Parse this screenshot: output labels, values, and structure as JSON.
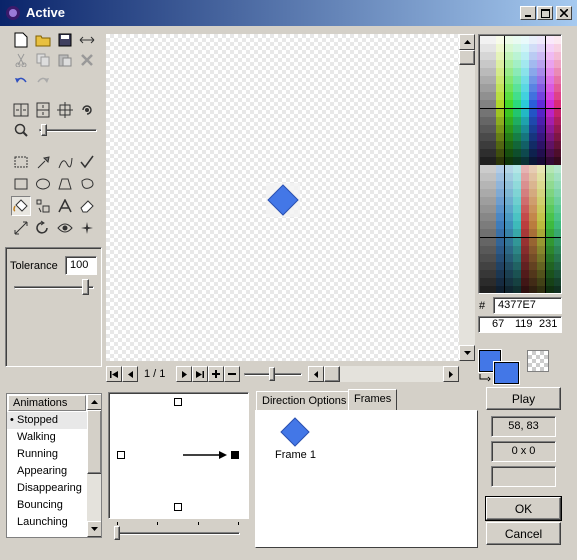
{
  "window": {
    "title": "Active"
  },
  "tools": {
    "tolerance_label": "Tolerance",
    "tolerance_value": "100"
  },
  "canvas": {
    "frame_counter": "1 / 1"
  },
  "color": {
    "hex_prefix": "#",
    "hex_value": "4377E7",
    "r": "67",
    "g": "119",
    "b": "231",
    "primary": "#4377E7",
    "secondary": "#4377E7"
  },
  "animations": {
    "header": "Animations",
    "items": [
      "Stopped",
      "Walking",
      "Running",
      "Appearing",
      "Disappearing",
      "Bouncing",
      "Launching"
    ],
    "selected": "Stopped"
  },
  "tabs": {
    "direction_options": "Direction Options",
    "frames": "Frames",
    "active": "Frames"
  },
  "frames": [
    {
      "label": "Frame 1"
    }
  ],
  "buttons": {
    "play": "Play",
    "ok": "OK",
    "cancel": "Cancel"
  },
  "status": {
    "coords": "58, 83",
    "size": "0 x 0",
    "extra": ""
  }
}
